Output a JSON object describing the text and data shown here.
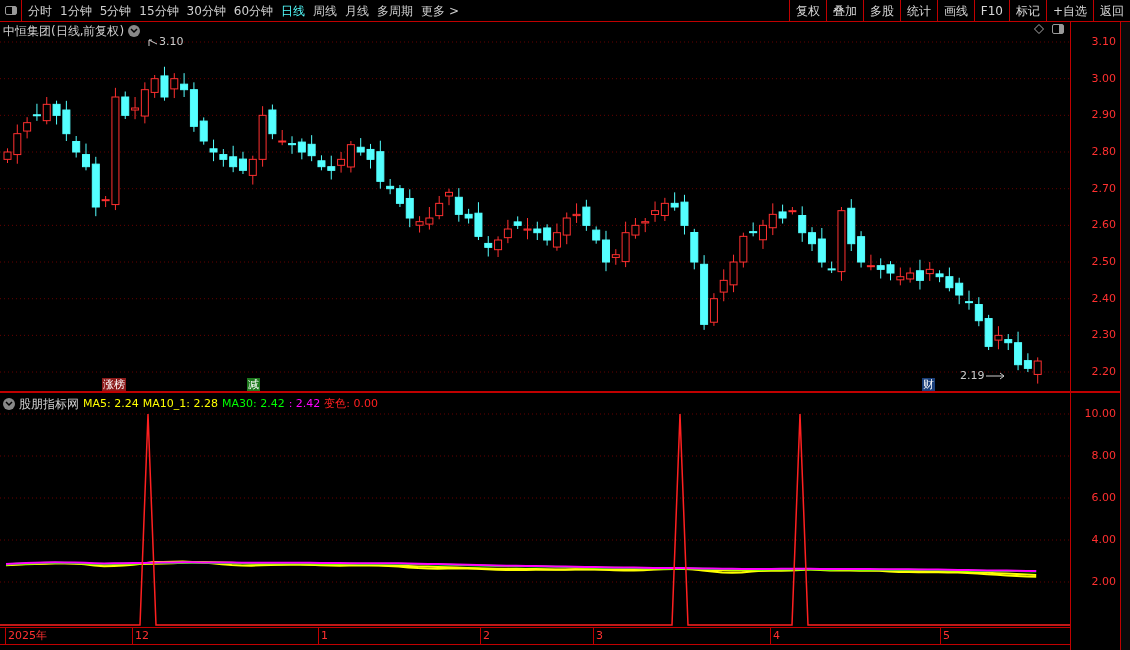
{
  "toolbar": {
    "periods": [
      {
        "label": "分时",
        "selected": false
      },
      {
        "label": "1分钟",
        "selected": false
      },
      {
        "label": "5分钟",
        "selected": false
      },
      {
        "label": "15分钟",
        "selected": false
      },
      {
        "label": "30分钟",
        "selected": false
      },
      {
        "label": "60分钟",
        "selected": false
      },
      {
        "label": "日线",
        "selected": true
      },
      {
        "label": "周线",
        "selected": false
      },
      {
        "label": "月线",
        "selected": false
      },
      {
        "label": "多周期",
        "selected": false
      },
      {
        "label": "更多 >",
        "selected": false
      }
    ],
    "buttons": [
      "复权",
      "叠加",
      "多股",
      "统计",
      "画线",
      "F10",
      "标记",
      "+自选",
      "返回"
    ]
  },
  "price_chart": {
    "title": "中恒集团(日线,前复权)",
    "high_label": "3.10",
    "low_label": "2.19",
    "yticks": [
      "3.10",
      "3.00",
      "2.90",
      "2.80",
      "2.70",
      "2.60",
      "2.50",
      "2.40",
      "2.30",
      "2.20"
    ],
    "event_tags": [
      {
        "label": "涨榜",
        "color": "#8b1a1a"
      },
      {
        "label": "减",
        "color": "#1e7a1e"
      },
      {
        "label": "财",
        "color": "#1a3f7a"
      }
    ]
  },
  "indicator": {
    "name": "股朋指标网",
    "values": [
      {
        "label": "MA5: 2.24",
        "color": "#ffff00"
      },
      {
        "label": "MA10_1: 2.28",
        "color": "#ffff00"
      },
      {
        "label": "MA30: 2.42",
        "color": "#00ff00"
      },
      {
        "label": ": 2.42",
        "color": "#ff00ff"
      },
      {
        "label": "变色: 0.00",
        "color": "#ff2020"
      }
    ],
    "yticks": [
      "10.00",
      "8.00",
      "6.00",
      "4.00",
      "2.00"
    ]
  },
  "date_axis": [
    "2025年",
    "12",
    "1",
    "2",
    "3",
    "4",
    "5"
  ]
}
